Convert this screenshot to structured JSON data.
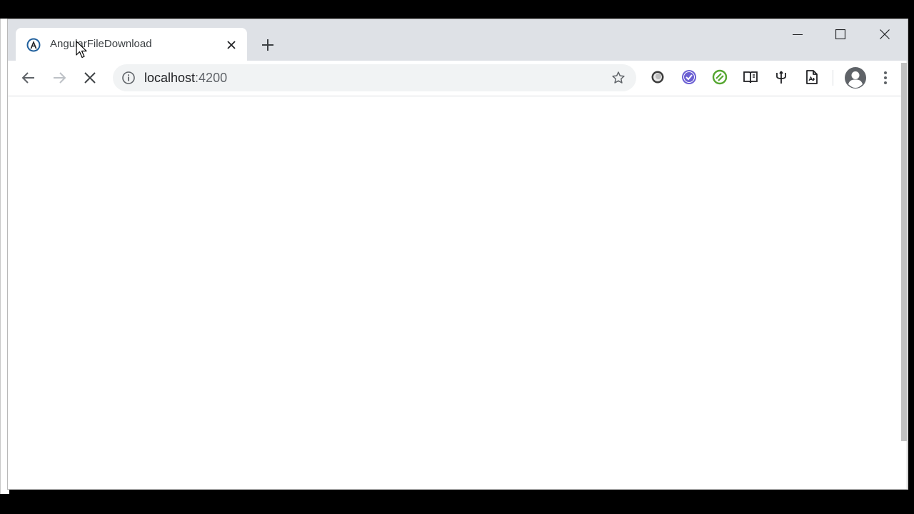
{
  "tab": {
    "title": "AngularFileDownload",
    "favicon": "angular-icon"
  },
  "address_bar": {
    "host": "localhost",
    "port": ":4200"
  },
  "toolbar": {
    "back": "back-arrow-icon",
    "forward": "forward-arrow-icon",
    "stop": "stop-loading-icon"
  },
  "extensions": [
    "circle-extension-icon",
    "check-badge-extension-icon",
    "green-circle-extension-icon",
    "reader-extension-icon",
    "trident-extension-icon",
    "document-extension-icon"
  ],
  "colors": {
    "tabstrip": "#dee1e6",
    "omnibox": "#f1f3f4",
    "ext_purple": "#6b5fd3",
    "ext_green": "#55a630"
  }
}
